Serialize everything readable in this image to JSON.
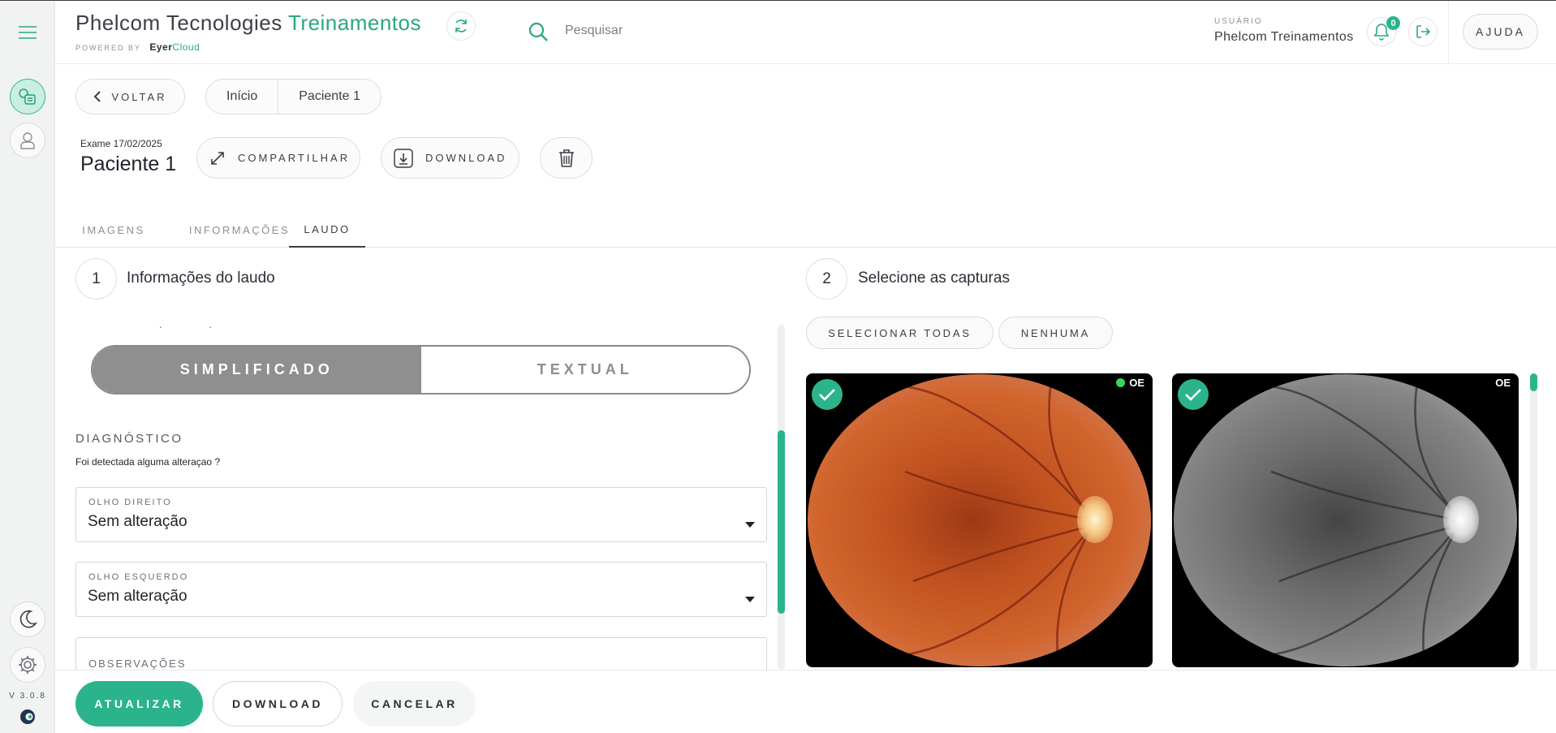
{
  "header": {
    "brand_main": "Phelcom Tecnologies",
    "brand_accent": "Treinamentos",
    "powered_by": "POWERED BY",
    "powered_brand": "Eyer",
    "powered_brand_accent": "Cloud",
    "search_placeholder": "Pesquisar",
    "user_caption": "USUÁRIO",
    "user_name": "Phelcom Treinamentos",
    "notification_count": "0",
    "help_label": "AJUDA"
  },
  "sidebar": {
    "version": "V 3.0.8"
  },
  "nav": {
    "back_label": "VOLTAR",
    "breadcrumb": [
      "Início",
      "Paciente 1"
    ]
  },
  "exam": {
    "date_label": "Exame 17/02/2025",
    "patient": "Paciente 1",
    "share_label": "COMPARTILHAR",
    "download_label": "DOWNLOAD"
  },
  "tabs": [
    {
      "label": "IMAGENS",
      "active": false
    },
    {
      "label": "INFORMAÇÕES",
      "active": false
    },
    {
      "label": "LAUDO",
      "active": true
    }
  ],
  "report": {
    "step1_number": "1",
    "step1_title": "Informações do laudo",
    "mode_options": [
      "SIMPLIFICADO",
      "TEXTUAL"
    ],
    "mode_selected": "SIMPLIFICADO",
    "diagnosis_label": "DIAGNÓSTICO",
    "diagnosis_question": "Foi detectada alguma alteraçao ?",
    "right_eye_label": "OLHO DIREITO",
    "right_eye_value": "Sem alteração",
    "left_eye_label": "OLHO ESQUERDO",
    "left_eye_value": "Sem alteração",
    "observations_label": "OBSERVAÇÕES"
  },
  "captures": {
    "step2_number": "2",
    "step2_title": "Selecione as capturas",
    "select_all_label": "SELECIONAR TODAS",
    "none_label": "NENHUMA",
    "items": [
      {
        "eye": "OE",
        "type": "color",
        "selected": true,
        "status_dot": true
      },
      {
        "eye": "OE",
        "type": "red-free",
        "selected": true,
        "status_dot": false
      }
    ]
  },
  "footer": {
    "update_label": "ATUALIZAR",
    "download_label": "DOWNLOAD",
    "cancel_label": "CANCELAR"
  },
  "colors": {
    "accent": "#2bb48c",
    "toggle_active": "#8f8f8f"
  }
}
